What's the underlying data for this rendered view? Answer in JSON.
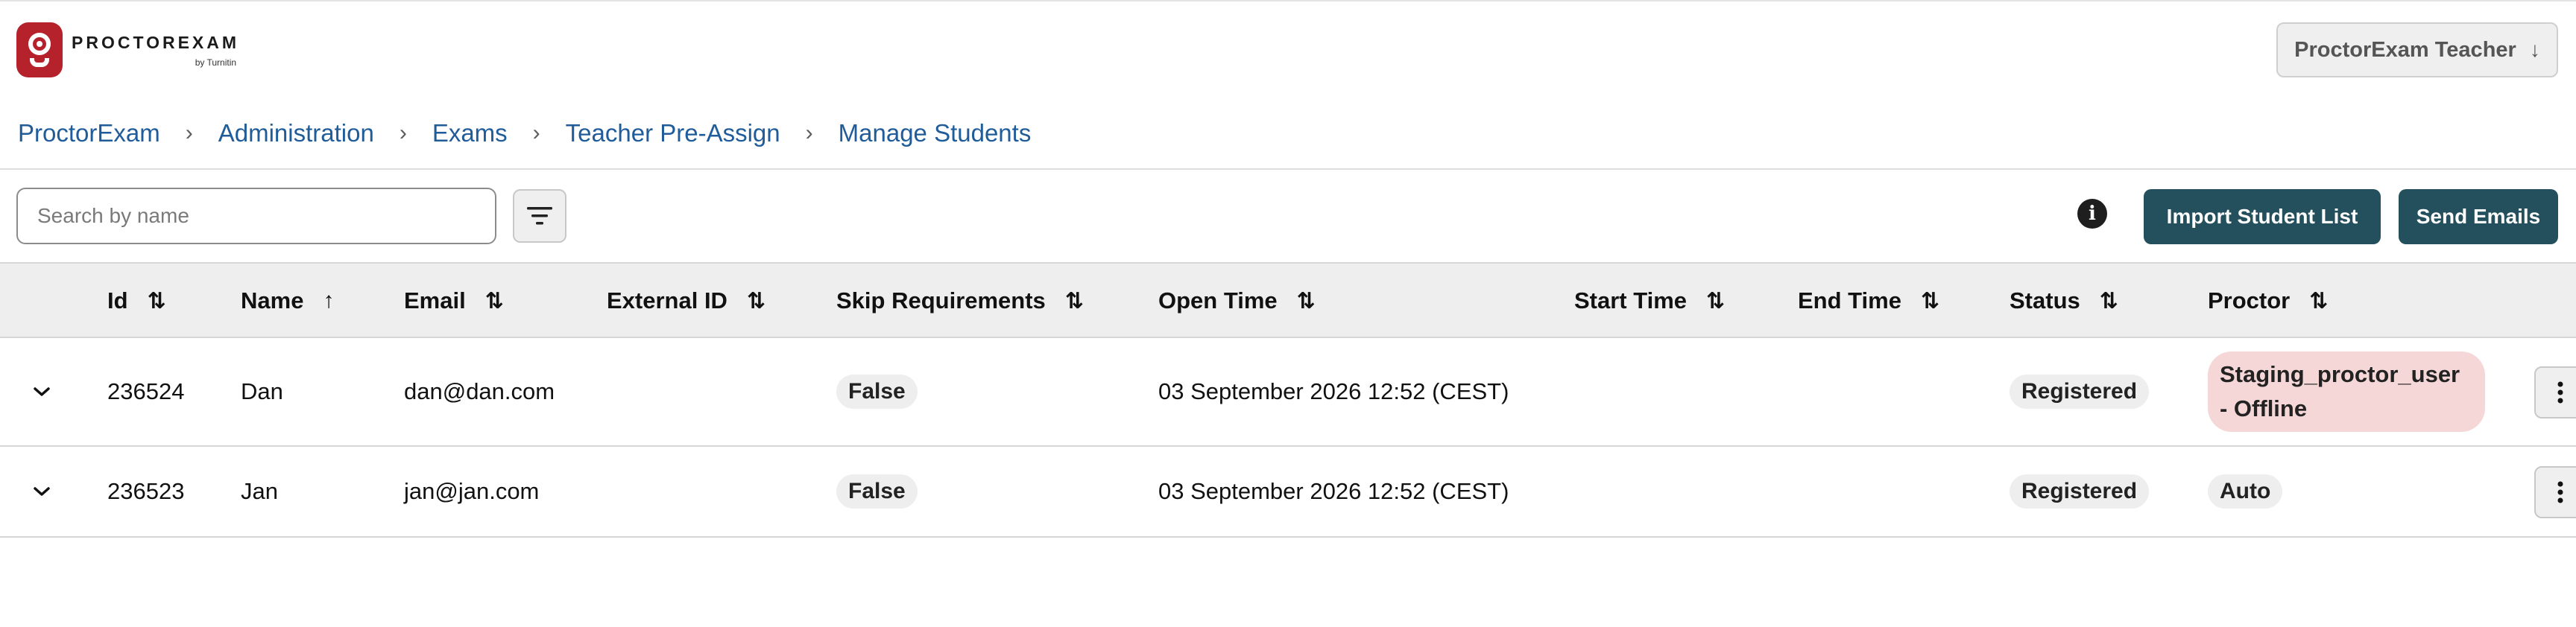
{
  "header": {
    "brand": "PROCTOREXAM",
    "brand_sub": "by Turnitin",
    "user_menu_label": "ProctorExam Teacher",
    "user_menu_arrow": "↓"
  },
  "breadcrumb": {
    "items": [
      "ProctorExam",
      "Administration",
      "Exams",
      "Teacher Pre-Assign",
      "Manage Students"
    ],
    "separator": "›"
  },
  "toolbar": {
    "search_placeholder": "Search by name",
    "import_label": "Import Student List",
    "send_label": "Send Emails",
    "info_glyph": "i"
  },
  "table": {
    "columns": [
      {
        "key": "id",
        "label": "Id",
        "sort": "⇅"
      },
      {
        "key": "name",
        "label": "Name",
        "sort": "↑"
      },
      {
        "key": "email",
        "label": "Email",
        "sort": "⇅"
      },
      {
        "key": "external_id",
        "label": "External ID",
        "sort": "⇅"
      },
      {
        "key": "skip_requirements",
        "label": "Skip Requirements",
        "sort": "⇅"
      },
      {
        "key": "open_time",
        "label": "Open Time",
        "sort": "⇅"
      },
      {
        "key": "start_time",
        "label": "Start Time",
        "sort": "⇅"
      },
      {
        "key": "end_time",
        "label": "End Time",
        "sort": "⇅"
      },
      {
        "key": "status",
        "label": "Status",
        "sort": "⇅"
      },
      {
        "key": "proctor",
        "label": "Proctor",
        "sort": "⇅"
      }
    ],
    "rows": [
      {
        "id": "236524",
        "name": "Dan",
        "email": "dan@dan.com",
        "external_id": "",
        "skip_requirements": "False",
        "open_time": "03 September 2026 12:52 (CEST)",
        "start_time": "",
        "end_time": "",
        "status": "Registered",
        "proctor": "Staging_proctor_user - Offline"
      },
      {
        "id": "236523",
        "name": "Jan",
        "email": "jan@jan.com",
        "external_id": "",
        "skip_requirements": "False",
        "open_time": "03 September 2026 12:52 (CEST)",
        "start_time": "",
        "end_time": "",
        "status": "Registered",
        "proctor": "Auto"
      }
    ]
  },
  "colors": {
    "primary_button": "#24505d",
    "link": "#1f5c99",
    "logo": "#b5222c",
    "offline_badge": "#f6d7d7"
  },
  "icons": {
    "filter": "filter-icon",
    "info": "info-icon",
    "expand": "chevron-down-icon",
    "row_menu": "kebab-menu-icon"
  }
}
